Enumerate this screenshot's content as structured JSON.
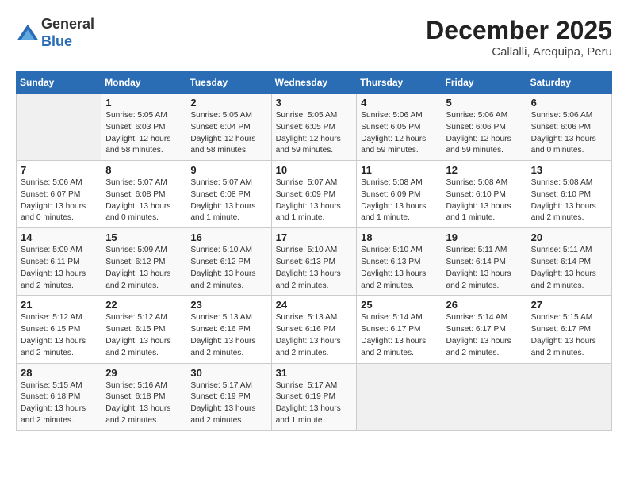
{
  "header": {
    "logo_general": "General",
    "logo_blue": "Blue",
    "month_title": "December 2025",
    "location": "Callalli, Arequipa, Peru"
  },
  "days_of_week": [
    "Sunday",
    "Monday",
    "Tuesday",
    "Wednesday",
    "Thursday",
    "Friday",
    "Saturday"
  ],
  "weeks": [
    [
      {
        "day": "",
        "info": ""
      },
      {
        "day": "1",
        "info": "Sunrise: 5:05 AM\nSunset: 6:03 PM\nDaylight: 12 hours\nand 58 minutes."
      },
      {
        "day": "2",
        "info": "Sunrise: 5:05 AM\nSunset: 6:04 PM\nDaylight: 12 hours\nand 58 minutes."
      },
      {
        "day": "3",
        "info": "Sunrise: 5:05 AM\nSunset: 6:05 PM\nDaylight: 12 hours\nand 59 minutes."
      },
      {
        "day": "4",
        "info": "Sunrise: 5:06 AM\nSunset: 6:05 PM\nDaylight: 12 hours\nand 59 minutes."
      },
      {
        "day": "5",
        "info": "Sunrise: 5:06 AM\nSunset: 6:06 PM\nDaylight: 12 hours\nand 59 minutes."
      },
      {
        "day": "6",
        "info": "Sunrise: 5:06 AM\nSunset: 6:06 PM\nDaylight: 13 hours\nand 0 minutes."
      }
    ],
    [
      {
        "day": "7",
        "info": "Sunrise: 5:06 AM\nSunset: 6:07 PM\nDaylight: 13 hours\nand 0 minutes."
      },
      {
        "day": "8",
        "info": "Sunrise: 5:07 AM\nSunset: 6:08 PM\nDaylight: 13 hours\nand 0 minutes."
      },
      {
        "day": "9",
        "info": "Sunrise: 5:07 AM\nSunset: 6:08 PM\nDaylight: 13 hours\nand 1 minute."
      },
      {
        "day": "10",
        "info": "Sunrise: 5:07 AM\nSunset: 6:09 PM\nDaylight: 13 hours\nand 1 minute."
      },
      {
        "day": "11",
        "info": "Sunrise: 5:08 AM\nSunset: 6:09 PM\nDaylight: 13 hours\nand 1 minute."
      },
      {
        "day": "12",
        "info": "Sunrise: 5:08 AM\nSunset: 6:10 PM\nDaylight: 13 hours\nand 1 minute."
      },
      {
        "day": "13",
        "info": "Sunrise: 5:08 AM\nSunset: 6:10 PM\nDaylight: 13 hours\nand 2 minutes."
      }
    ],
    [
      {
        "day": "14",
        "info": "Sunrise: 5:09 AM\nSunset: 6:11 PM\nDaylight: 13 hours\nand 2 minutes."
      },
      {
        "day": "15",
        "info": "Sunrise: 5:09 AM\nSunset: 6:12 PM\nDaylight: 13 hours\nand 2 minutes."
      },
      {
        "day": "16",
        "info": "Sunrise: 5:10 AM\nSunset: 6:12 PM\nDaylight: 13 hours\nand 2 minutes."
      },
      {
        "day": "17",
        "info": "Sunrise: 5:10 AM\nSunset: 6:13 PM\nDaylight: 13 hours\nand 2 minutes."
      },
      {
        "day": "18",
        "info": "Sunrise: 5:10 AM\nSunset: 6:13 PM\nDaylight: 13 hours\nand 2 minutes."
      },
      {
        "day": "19",
        "info": "Sunrise: 5:11 AM\nSunset: 6:14 PM\nDaylight: 13 hours\nand 2 minutes."
      },
      {
        "day": "20",
        "info": "Sunrise: 5:11 AM\nSunset: 6:14 PM\nDaylight: 13 hours\nand 2 minutes."
      }
    ],
    [
      {
        "day": "21",
        "info": "Sunrise: 5:12 AM\nSunset: 6:15 PM\nDaylight: 13 hours\nand 2 minutes."
      },
      {
        "day": "22",
        "info": "Sunrise: 5:12 AM\nSunset: 6:15 PM\nDaylight: 13 hours\nand 2 minutes."
      },
      {
        "day": "23",
        "info": "Sunrise: 5:13 AM\nSunset: 6:16 PM\nDaylight: 13 hours\nand 2 minutes."
      },
      {
        "day": "24",
        "info": "Sunrise: 5:13 AM\nSunset: 6:16 PM\nDaylight: 13 hours\nand 2 minutes."
      },
      {
        "day": "25",
        "info": "Sunrise: 5:14 AM\nSunset: 6:17 PM\nDaylight: 13 hours\nand 2 minutes."
      },
      {
        "day": "26",
        "info": "Sunrise: 5:14 AM\nSunset: 6:17 PM\nDaylight: 13 hours\nand 2 minutes."
      },
      {
        "day": "27",
        "info": "Sunrise: 5:15 AM\nSunset: 6:17 PM\nDaylight: 13 hours\nand 2 minutes."
      }
    ],
    [
      {
        "day": "28",
        "info": "Sunrise: 5:15 AM\nSunset: 6:18 PM\nDaylight: 13 hours\nand 2 minutes."
      },
      {
        "day": "29",
        "info": "Sunrise: 5:16 AM\nSunset: 6:18 PM\nDaylight: 13 hours\nand 2 minutes."
      },
      {
        "day": "30",
        "info": "Sunrise: 5:17 AM\nSunset: 6:19 PM\nDaylight: 13 hours\nand 2 minutes."
      },
      {
        "day": "31",
        "info": "Sunrise: 5:17 AM\nSunset: 6:19 PM\nDaylight: 13 hours\nand 1 minute."
      },
      {
        "day": "",
        "info": ""
      },
      {
        "day": "",
        "info": ""
      },
      {
        "day": "",
        "info": ""
      }
    ]
  ]
}
